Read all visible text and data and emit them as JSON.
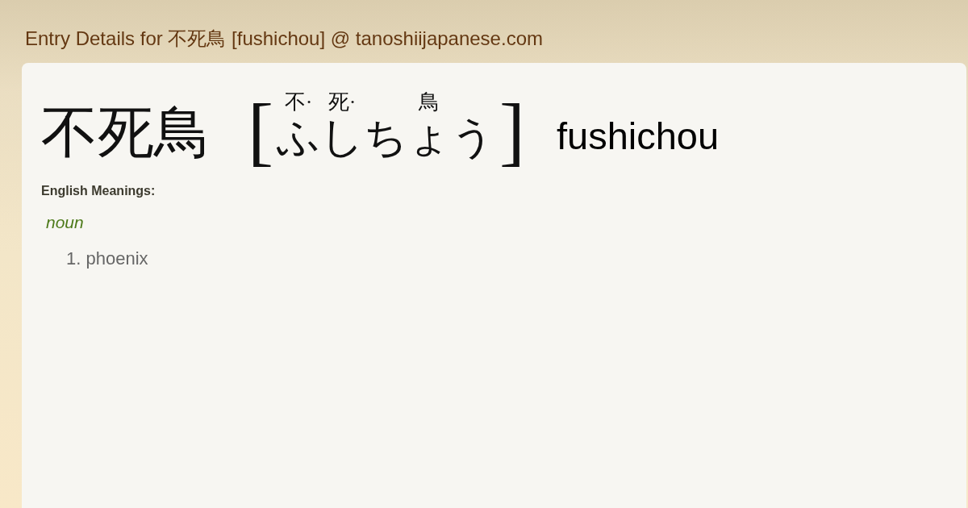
{
  "page_title": "Entry Details for 不死鳥 [fushichou] @ tanoshiijapanese.com",
  "entry": {
    "kanji": "不死鳥",
    "open_bracket": "[",
    "reading": [
      {
        "furigana": "不·",
        "kana": "ふ"
      },
      {
        "furigana": "死·",
        "kana": "し"
      },
      {
        "furigana": "鳥",
        "kana": "ちょう"
      }
    ],
    "close_bracket": "]",
    "romaji": "fushichou"
  },
  "meanings": {
    "heading": "English Meanings:",
    "groups": [
      {
        "part_of_speech": "noun",
        "senses": [
          {
            "number": "1.",
            "text": "phoenix"
          }
        ]
      }
    ]
  }
}
